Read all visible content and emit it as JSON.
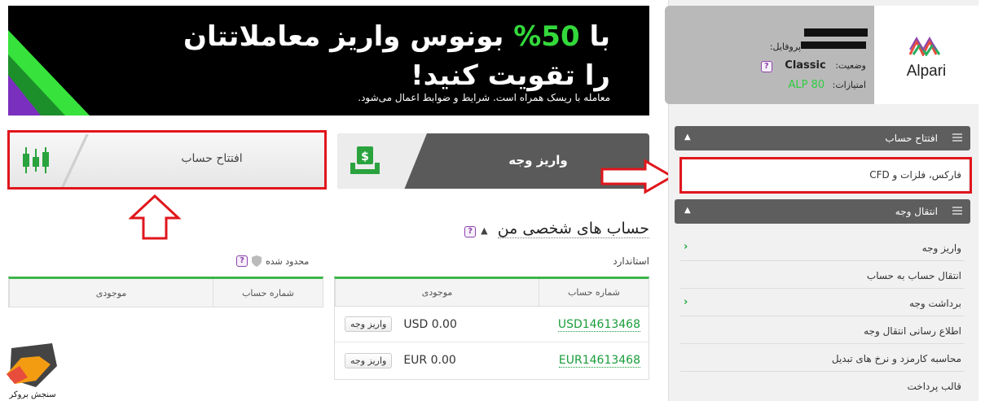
{
  "banner": {
    "line1_prefix": "با",
    "line1_percent": "50%",
    "line1_suffix": "بونوس واریز معاملاتتان",
    "line2": "را تقویت کنید!",
    "line3": "معامله با ریسک همراه است. شرایط و ضوابط اعمال می‌شود."
  },
  "buttons": {
    "open_account": "افتتاح حساب",
    "deposit": "واریز وجه"
  },
  "accounts": {
    "title": "حساب های شخصی من",
    "standard": {
      "label": "استاندارد",
      "col_account": "شماره حساب",
      "col_balance": "موجودی",
      "rows": [
        {
          "account": "USD14613468",
          "balance": "USD 0.00",
          "action": "واریز وجه"
        },
        {
          "account": "EUR14613468",
          "balance": "EUR 0.00",
          "action": "واریز وجه"
        }
      ]
    },
    "limited": {
      "label": "محدود شده",
      "col_account": "شماره حساب",
      "col_balance": "موجودی"
    }
  },
  "profile": {
    "profile_label": "پروفایل:",
    "status_label": "وضعیت:",
    "status_value": "Classic",
    "points_label": "امتیازات:",
    "points_value": "ALP 80",
    "brand": "Alpari"
  },
  "sidebar": {
    "open_account_header": "افتتاح حساب",
    "open_account_item": "فارکس، فلزات و CFD",
    "transfer_header": "انتقال وجه",
    "transfer_items": [
      {
        "label": "واریز وجه",
        "chevron": true
      },
      {
        "label": "انتقال حساب به حساب",
        "chevron": false
      },
      {
        "label": "برداشت وجه",
        "chevron": true
      },
      {
        "label": "اطلاع رسانی انتقال وجه",
        "chevron": false
      },
      {
        "label": "محاسبه کارمزد و نرخ های تبدیل",
        "chevron": false
      },
      {
        "label": "قالب پرداخت",
        "chevron": false
      }
    ]
  },
  "watermark": {
    "text": "سنجش بروکر"
  },
  "colors": {
    "accent_green": "#3cb54a",
    "highlight_red": "#e0161c",
    "purple": "#8e44ad"
  }
}
